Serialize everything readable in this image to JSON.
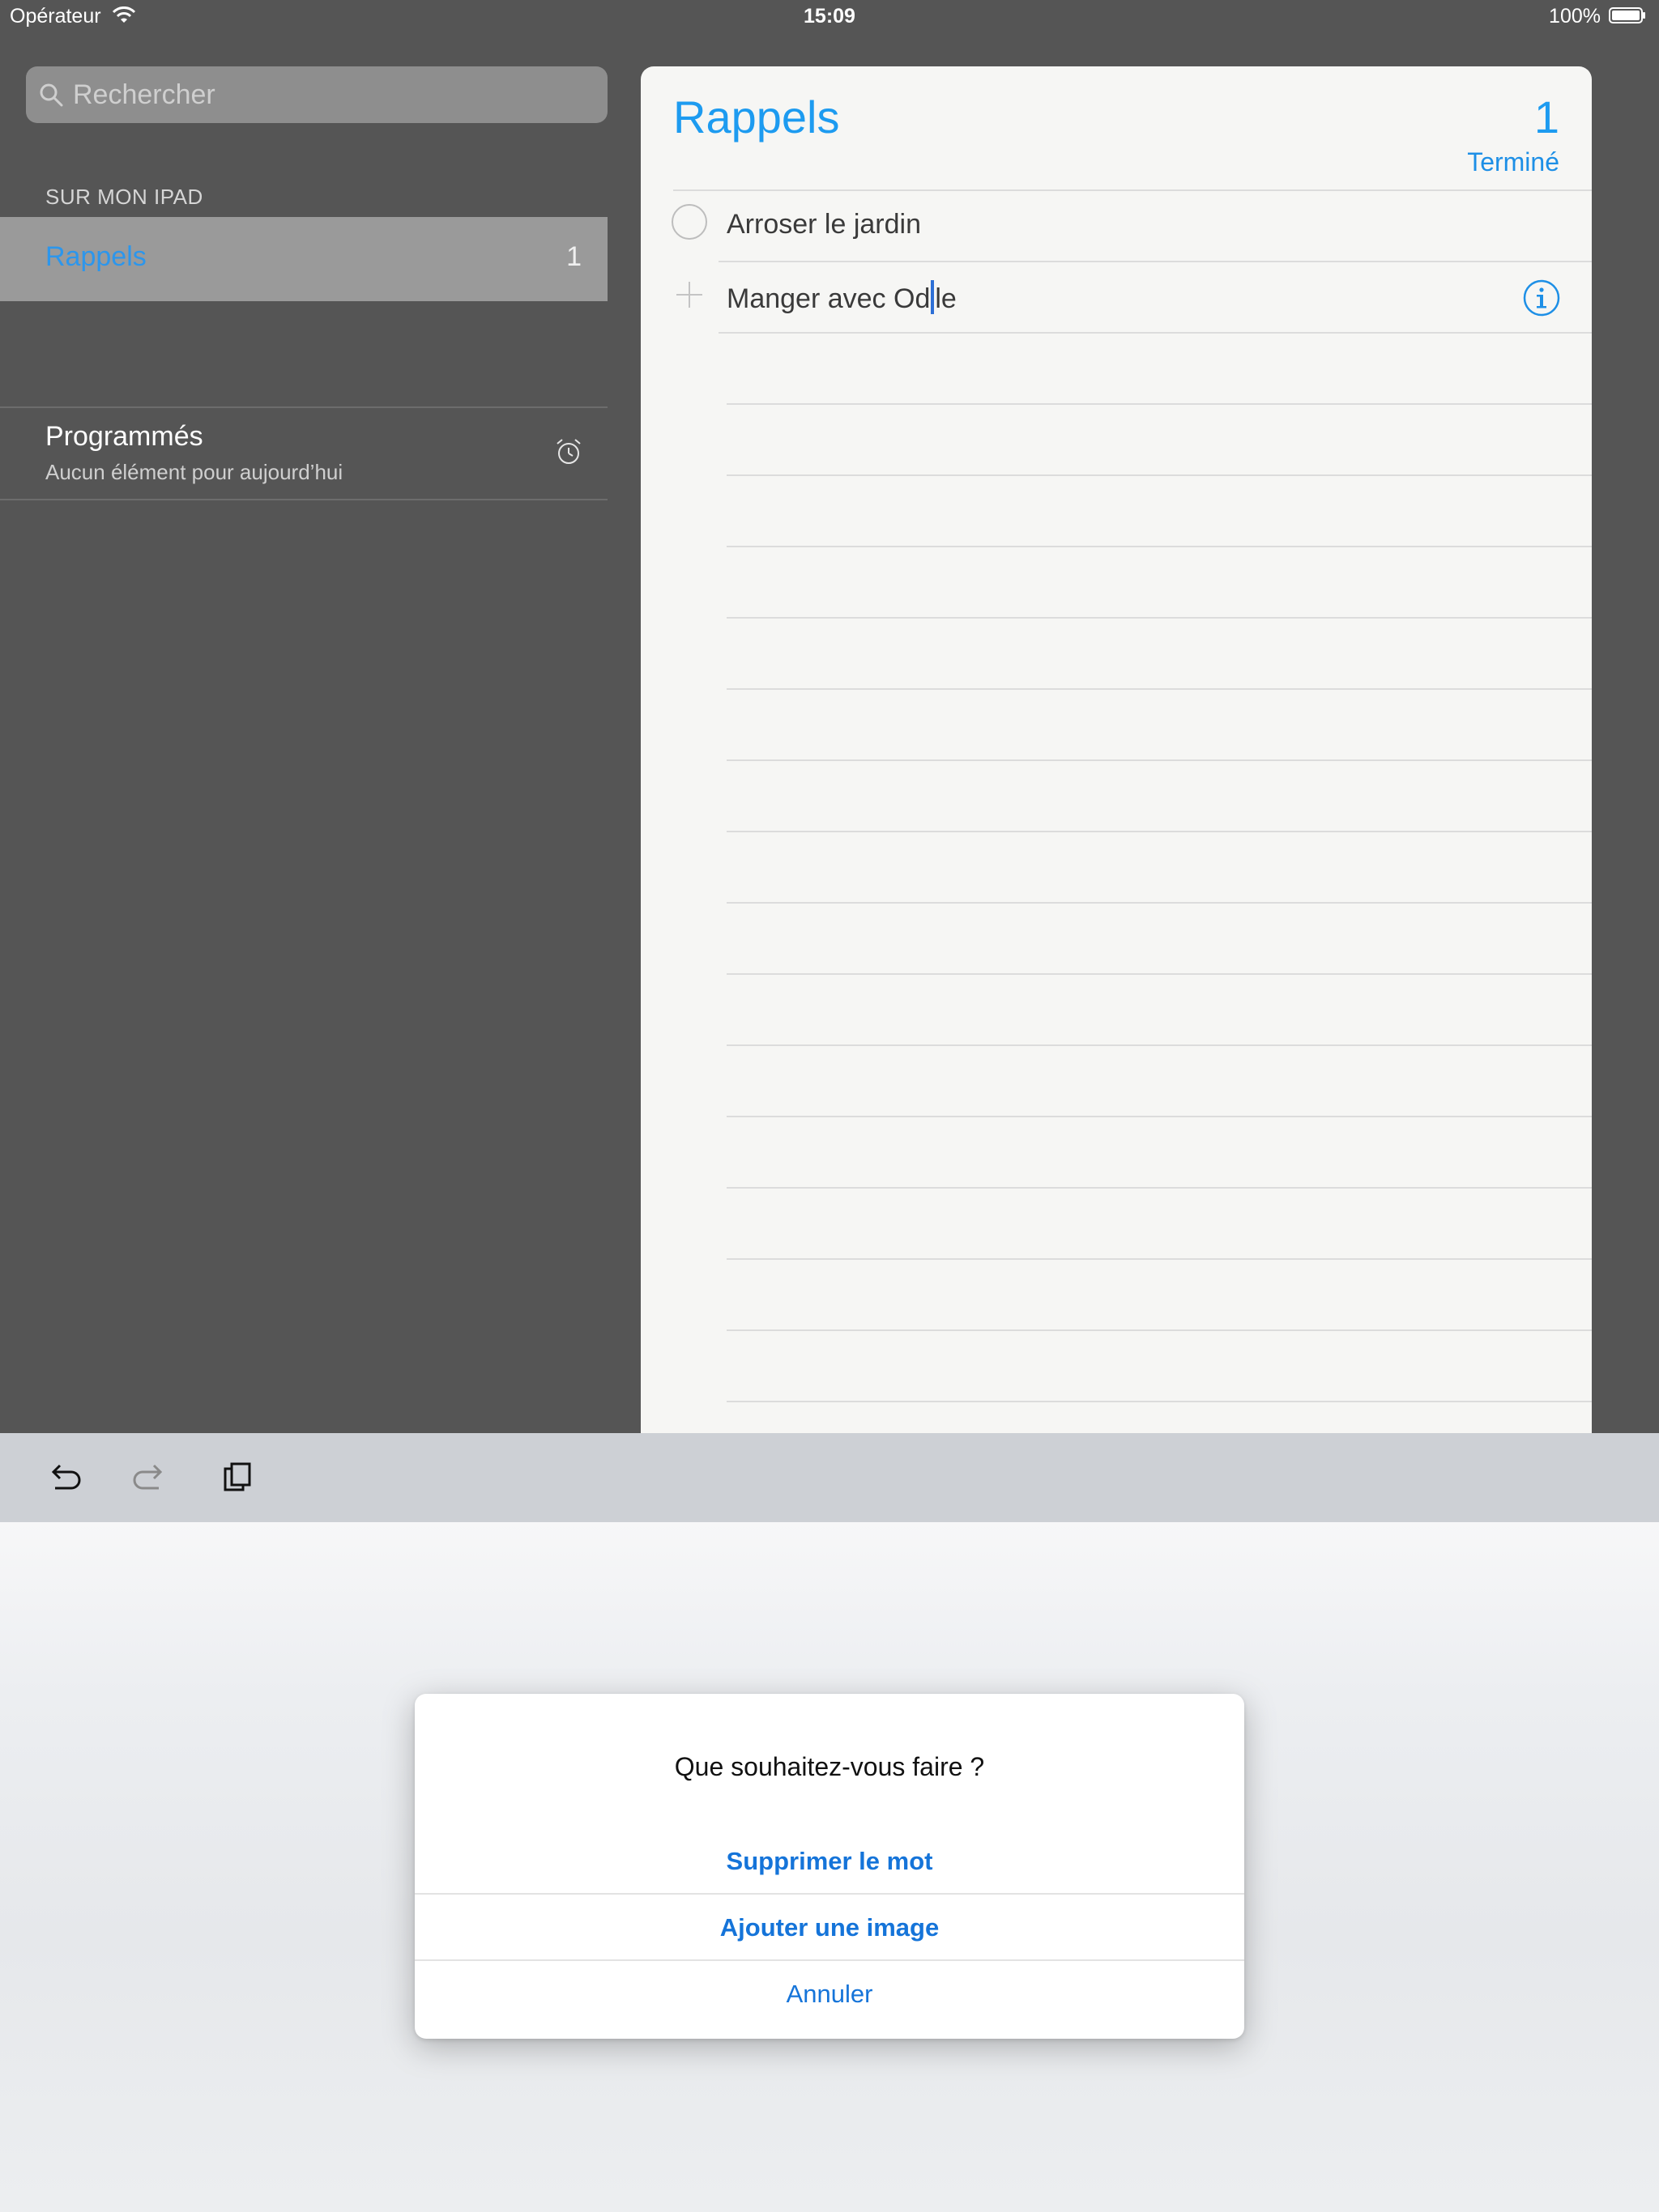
{
  "status_bar": {
    "carrier": "Opérateur",
    "time": "15:09",
    "battery": "100%"
  },
  "sidebar": {
    "search_placeholder": "Rechercher",
    "section_title": "SUR MON IPAD",
    "lists": [
      {
        "name": "Rappels",
        "count": "1"
      }
    ],
    "scheduled": {
      "title": "Programmés",
      "subtitle": "Aucun élément pour aujourd’hui"
    }
  },
  "sheet": {
    "title": "Rappels",
    "count": "1",
    "done_label": "Terminé",
    "items": [
      {
        "text": "Arroser le jardin"
      },
      {
        "text_before": "Manger avec Od",
        "text_after": "le"
      }
    ]
  },
  "alert": {
    "title": "Que souhaitez-vous faire ?",
    "actions": [
      {
        "label": "Supprimer le mot"
      },
      {
        "label": "Ajouter une image"
      },
      {
        "label": "Annuler"
      }
    ]
  },
  "colors": {
    "accent": "#1d9bf0",
    "sidebar_bg": "#555555",
    "selected_bg": "#9a9a9a"
  }
}
